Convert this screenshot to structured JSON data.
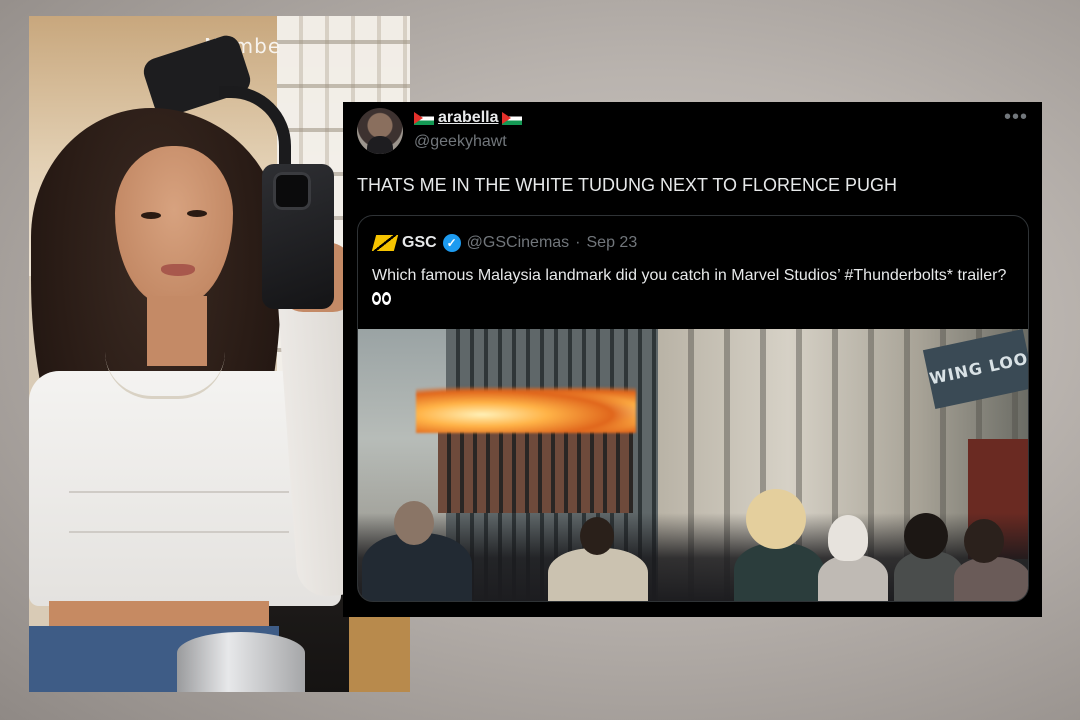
{
  "photo": {
    "sign_text": "Numbe"
  },
  "tweet": {
    "display_name": "arabella",
    "handle": "@geekyhawt",
    "more_icon": "more-horizontal-icon",
    "text": "THATS ME IN THE WHITE TUDUNG NEXT TO FLORENCE PUGH"
  },
  "quoted_tweet": {
    "name": "GSC",
    "verified": true,
    "handle": "@GSCinemas",
    "separator": "·",
    "date": "Sep 23",
    "text": "Which famous Malaysia landmark did you catch in Marvel Studios’ #Thunderbolts* trailer?",
    "emoji_icon": "eyes-icon",
    "media_sign_text": "WING LOO"
  },
  "colors": {
    "background": "#000000",
    "text": "#e7e9ea",
    "muted": "#71767b",
    "border": "#2f3336",
    "verified": "#1d9bf0",
    "gsc_logo": "#f6c400"
  }
}
